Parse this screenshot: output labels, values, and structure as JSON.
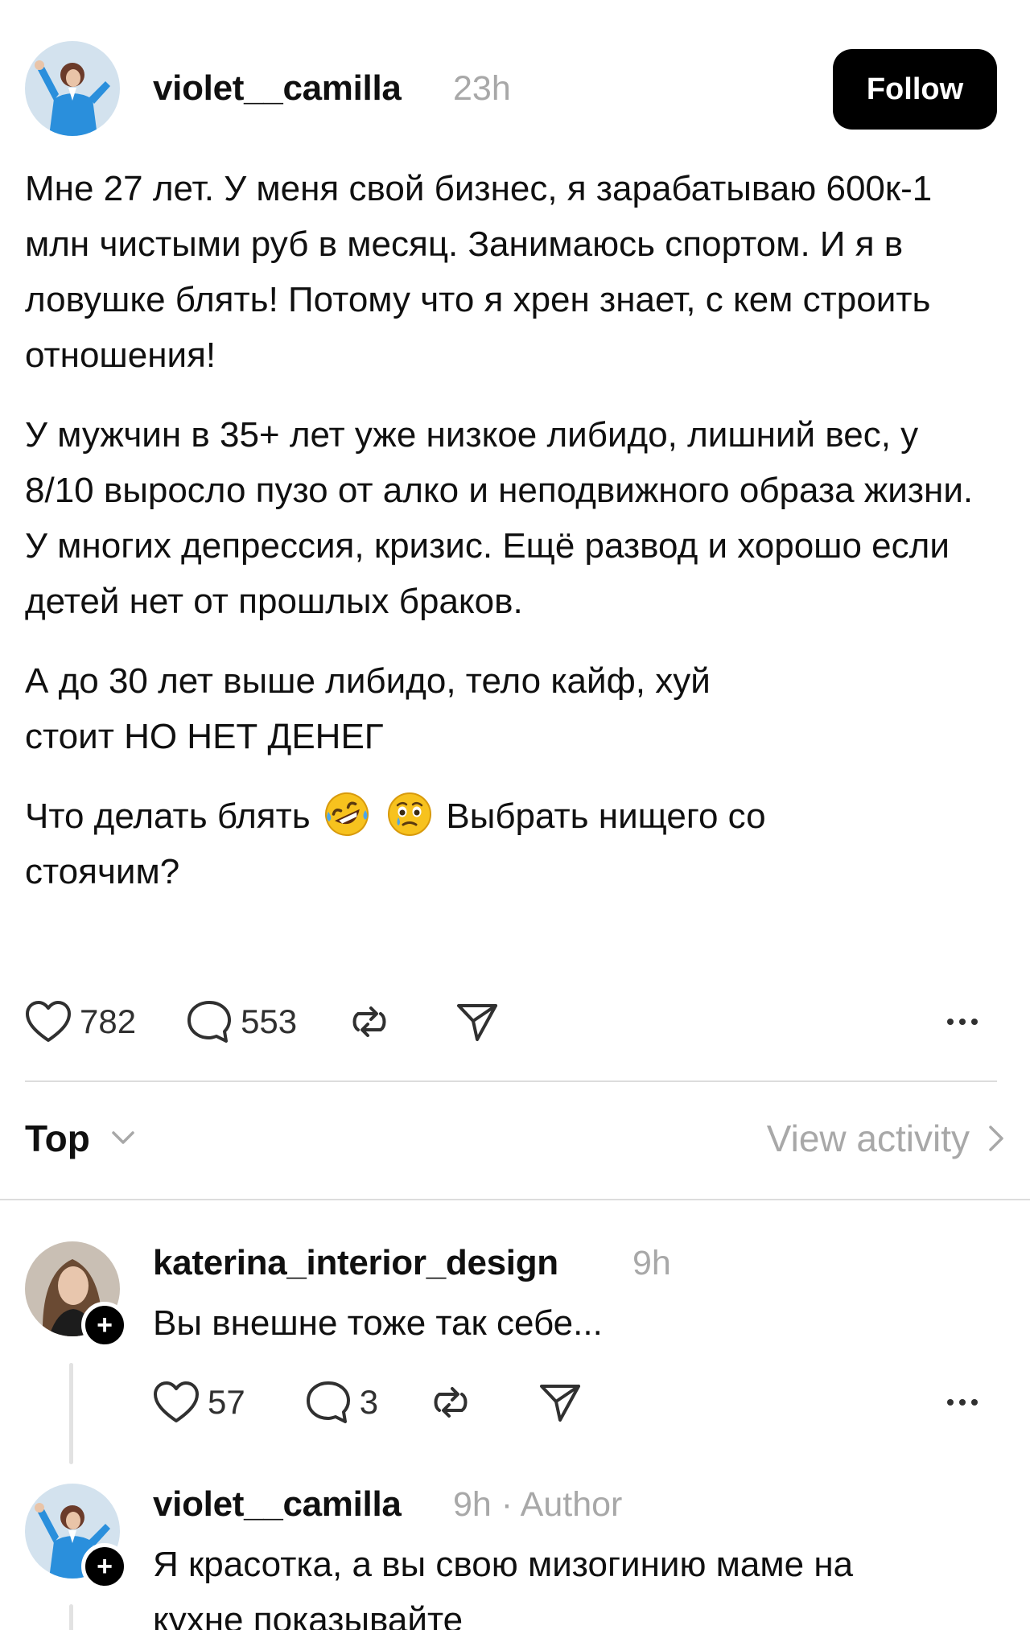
{
  "post": {
    "author": "violet__camilla",
    "time": "23h",
    "follow_label": "Follow",
    "paragraphs": [
      "Мне 27 лет. У меня свой бизнес, я зарабатываю 600к-1 млн чистыми руб в месяц. Занимаюсь спортом. И я в ловушке блять! Потому что я хрен знает, с кем строить отношения!",
      "У мужчин в 35+ лет уже низкое либидо, лишний вес, у 8/10 выросло пузо от алко и неподвижного образа жизни. У многих депрессия, кризис. Ещё развод и хорошо если детей нет от прошлых браков.",
      "А до 30 лет выше либидо, тело кайф, хуй стоит НО НЕТ ДЕНЕГ"
    ],
    "last_paragraph": {
      "before_emoji": "Что делать блять",
      "emojis": [
        "rolling-on-floor-laughing-emoji",
        "face-holding-back-tears-emoji"
      ],
      "after_emoji": "Выбрать нищего со стоячим?"
    },
    "likes": "782",
    "comments": "553"
  },
  "sort": {
    "label": "Top",
    "view_activity": "View activity"
  },
  "replies": [
    {
      "author": "katerina_interior_design",
      "time": "9h",
      "text": "Вы внешне тоже так себе...",
      "likes": "57",
      "comments": "3"
    },
    {
      "author": "violet__camilla",
      "time": "9h · Author",
      "text_line1": "Я красотка, а вы свою мизогинию маме на",
      "text_line2": "кухне показывайте"
    }
  ],
  "icons": {
    "like": "heart-icon",
    "comment": "speech-bubble-icon",
    "repost": "repost-icon",
    "share": "send-icon",
    "more": "more-dots-icon",
    "follow_badge": "plus-icon"
  },
  "colors": {
    "text": "#101010",
    "muted": "#a8a8a8",
    "follow_bg": "#000000",
    "avatar_bg": "#cfe0ef",
    "avatar_outfit": "#2a8fdc"
  }
}
